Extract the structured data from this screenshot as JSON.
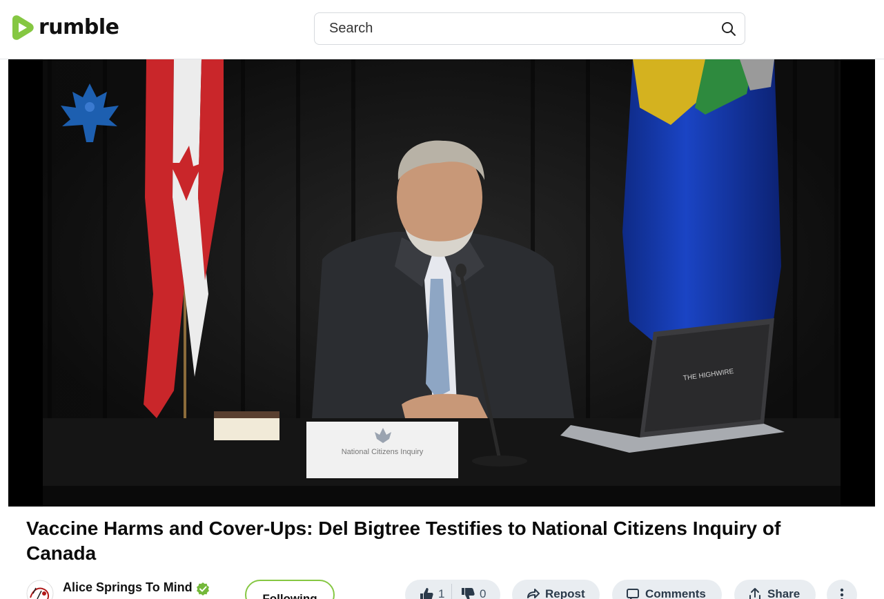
{
  "header": {
    "logo_text": "rumble",
    "search_placeholder": "Search"
  },
  "video": {
    "nameplate_text": "National Citizens Inquiry"
  },
  "title": "Vaccine Harms and Cover-Ups: Del Bigtree Testifies to National Citizens Inquiry of Canada",
  "channel": {
    "name": "Alice Springs To Mind",
    "verified": true,
    "follow_label": "Following"
  },
  "actions": {
    "likes": "1",
    "dislikes": "0",
    "repost_label": "Repost",
    "comments_label": "Comments",
    "share_label": "Share"
  },
  "colors": {
    "brand_green": "#85c742",
    "pill_bg": "#e9edf1",
    "verified_green": "#74b83a"
  }
}
